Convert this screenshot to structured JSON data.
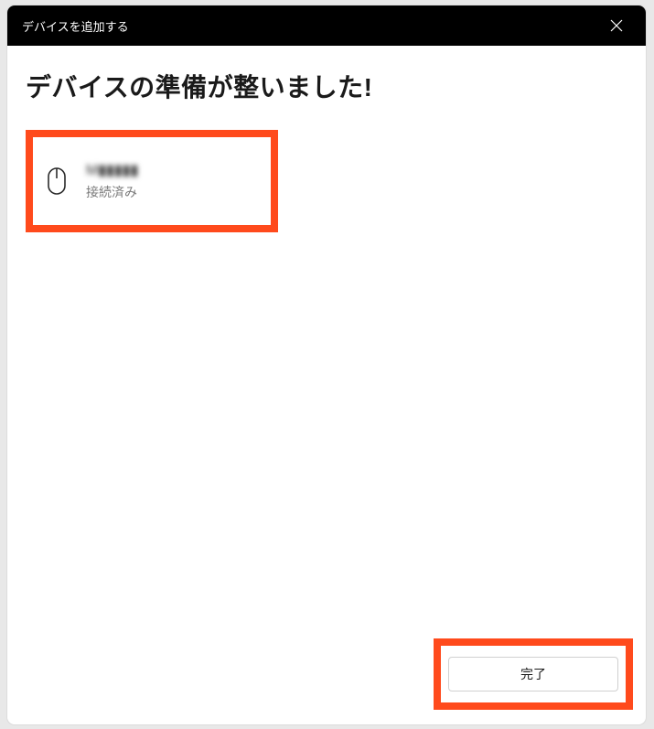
{
  "titlebar": {
    "title": "デバイスを追加する"
  },
  "main": {
    "heading": "デバイスの準備が整いました!",
    "device": {
      "name": "M▮▮▮▮▮",
      "status": "接続済み"
    }
  },
  "footer": {
    "done_label": "完了"
  },
  "colors": {
    "highlight": "#ff4a1c"
  }
}
